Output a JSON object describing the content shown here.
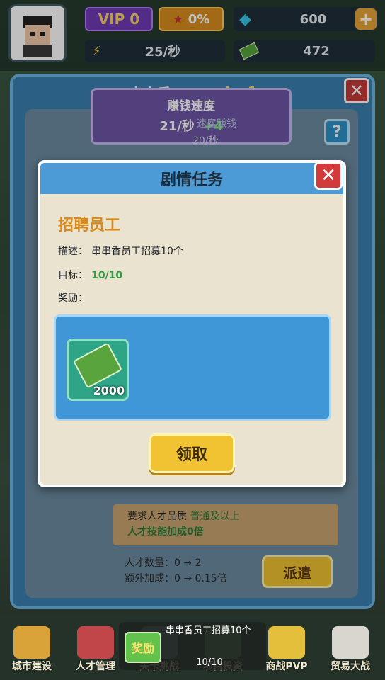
{
  "hud": {
    "vip_label": "VIP 0",
    "star_percent": "0%",
    "gems": "600",
    "speed": "25/秒",
    "cash": "472",
    "plus_label": "+"
  },
  "bg_panel": {
    "shop_name": "串串香",
    "level": "Lv.1",
    "speed_title": "赚钱速度",
    "speed_value": "21/秒",
    "speed_bonus": "+4",
    "speed_sub": "20/秒",
    "rush_label": "速雇赚钱",
    "help_label": "?",
    "req_quality": "要求人才品质",
    "req_quality_value": "普通及以上",
    "skill_bonus": "人才技能加成0倍",
    "talent_count": "人才数量：0 → 2",
    "extra_bonus": "额外加成：0 → 0.15倍",
    "dispatch_label": "派遣"
  },
  "modal": {
    "title": "剧情任务",
    "task_name": "招聘员工",
    "desc_label": "描述：",
    "desc_text": "串串香员工招募10个",
    "goal_label": "目标：",
    "goal_value": "10/10",
    "reward_label": "奖励：",
    "reward_amount": "2000",
    "claim_label": "领取"
  },
  "bottom_nav": {
    "items": [
      {
        "label": "城市建设"
      },
      {
        "label": "人才管理"
      },
      {
        "label": "关卡挑战"
      },
      {
        "label": "项目投资"
      },
      {
        "label": "商战PVP"
      },
      {
        "label": "贸易大战"
      }
    ]
  },
  "toast": {
    "badge": "奖励",
    "text": "串串香员工招募10个",
    "progress": "10/10"
  },
  "colors": {
    "modal_header": "#4d9bd6",
    "task_name": "#d98916",
    "goal_green": "#2e9a40",
    "claim_button": "#f1c232"
  }
}
